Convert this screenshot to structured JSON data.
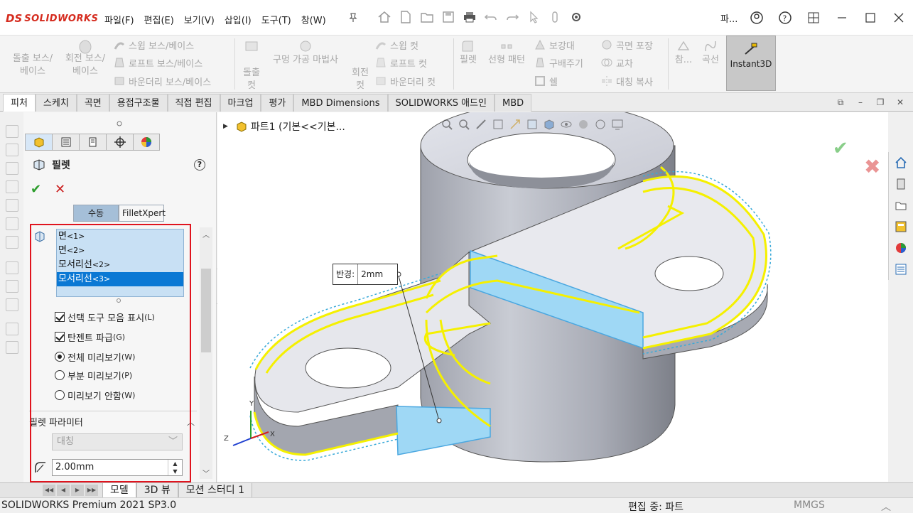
{
  "app": {
    "logo_prefix": "DS",
    "logo_name": "SOLIDWORKS",
    "menu": [
      "파일(F)",
      "편집(E)",
      "보기(V)",
      "삽입(I)",
      "도구(T)",
      "창(W)"
    ],
    "account_label": "파...",
    "icons": [
      "home-icon",
      "new-file-icon",
      "open-folder-icon",
      "save-icon",
      "print-icon",
      "undo-icon",
      "redo-icon",
      "select-cursor-icon",
      "rebuild-icon",
      "options-gear-icon",
      "user-icon",
      "help-icon"
    ]
  },
  "commands": {
    "extrude_boss": "돌출 보스/\n베이스",
    "revolve_boss": "회전 보스/\n베이스",
    "sweep_boss": "스윕 보스/베이스",
    "loft_boss": "로프트 보스/베이스",
    "boundary_boss": "바운더리 보스/베이스",
    "extrude_cut": "돌출\n컷",
    "hole_wizard": "구멍 가공 마법사",
    "revolve_cut": "회전\n컷",
    "sweep_cut": "스윕 컷",
    "loft_cut": "로프트 컷",
    "boundary_cut": "바운더리 컷",
    "fillet": "필렛",
    "linear_pattern": "선형 패턴",
    "rib": "보강대",
    "draft": "구배주기",
    "shell": "쉘",
    "wrap": "곡면 포장",
    "intersect": "교차",
    "mirror": "대칭 복사",
    "reference": "참...",
    "curves": "곡선",
    "instant3d": "Instant3D"
  },
  "tabs": [
    {
      "label": "피처",
      "active": true
    },
    {
      "label": "스케치",
      "active": false
    },
    {
      "label": "곡면",
      "active": false
    },
    {
      "label": "용접구조물",
      "active": false
    },
    {
      "label": "직접 편집",
      "active": false
    },
    {
      "label": "마크업",
      "active": false
    },
    {
      "label": "평가",
      "active": false
    },
    {
      "label": "MBD Dimensions",
      "active": false
    },
    {
      "label": "SOLIDWORKS 애드인",
      "active": false
    },
    {
      "label": "MBD",
      "active": false
    }
  ],
  "property_manager": {
    "title": "필렛",
    "mode_tabs": {
      "manual": "수동",
      "expert": "FilletXpert"
    },
    "selection_items": [
      {
        "name": "면",
        "index": "<1>",
        "selected": false
      },
      {
        "name": "면",
        "index": "<2>",
        "selected": false
      },
      {
        "name": "모서리선",
        "index": "<2>",
        "selected": false
      },
      {
        "name": "모서리선",
        "index": "<3>",
        "selected": true
      }
    ],
    "options": {
      "show_selection_toolbar": {
        "label": "선택 도구 모음 표시",
        "key": "(L)",
        "checked": true
      },
      "tangent_propagation": {
        "label": "탄젠트 파급",
        "key": "(G)",
        "checked": true
      },
      "full_preview": {
        "label": "전체 미리보기",
        "key": "(W)",
        "selected": true
      },
      "partial_preview": {
        "label": "부분 미리보기",
        "key": "(P)",
        "selected": false
      },
      "no_preview": {
        "label": "미리보기 안함",
        "key": "(W)",
        "selected": false
      }
    },
    "section_title": "필렛 파라미터",
    "fillet_method": "대칭",
    "radius": "2.00mm"
  },
  "viewport": {
    "tree_label": "파트1  (기본<<기본...",
    "dimension": {
      "label": "반경:",
      "value": "2mm"
    },
    "axis": {
      "x": "X",
      "y": "Y",
      "z": "Z"
    }
  },
  "bottom_tabs": [
    {
      "label": "모델",
      "active": true
    },
    {
      "label": "3D 뷰",
      "active": false
    },
    {
      "label": "모션 스터디 1",
      "active": false
    }
  ],
  "status": {
    "product": "SOLIDWORKS Premium 2021 SP3.0",
    "editing": "편집 중: 파트",
    "units": "MMGS"
  },
  "colors": {
    "selection_blue": "#0a78d4",
    "fillet_preview_yellow": "#f5f000",
    "highlight_red": "#e0141e",
    "face_highlight": "#9fd8f5"
  }
}
